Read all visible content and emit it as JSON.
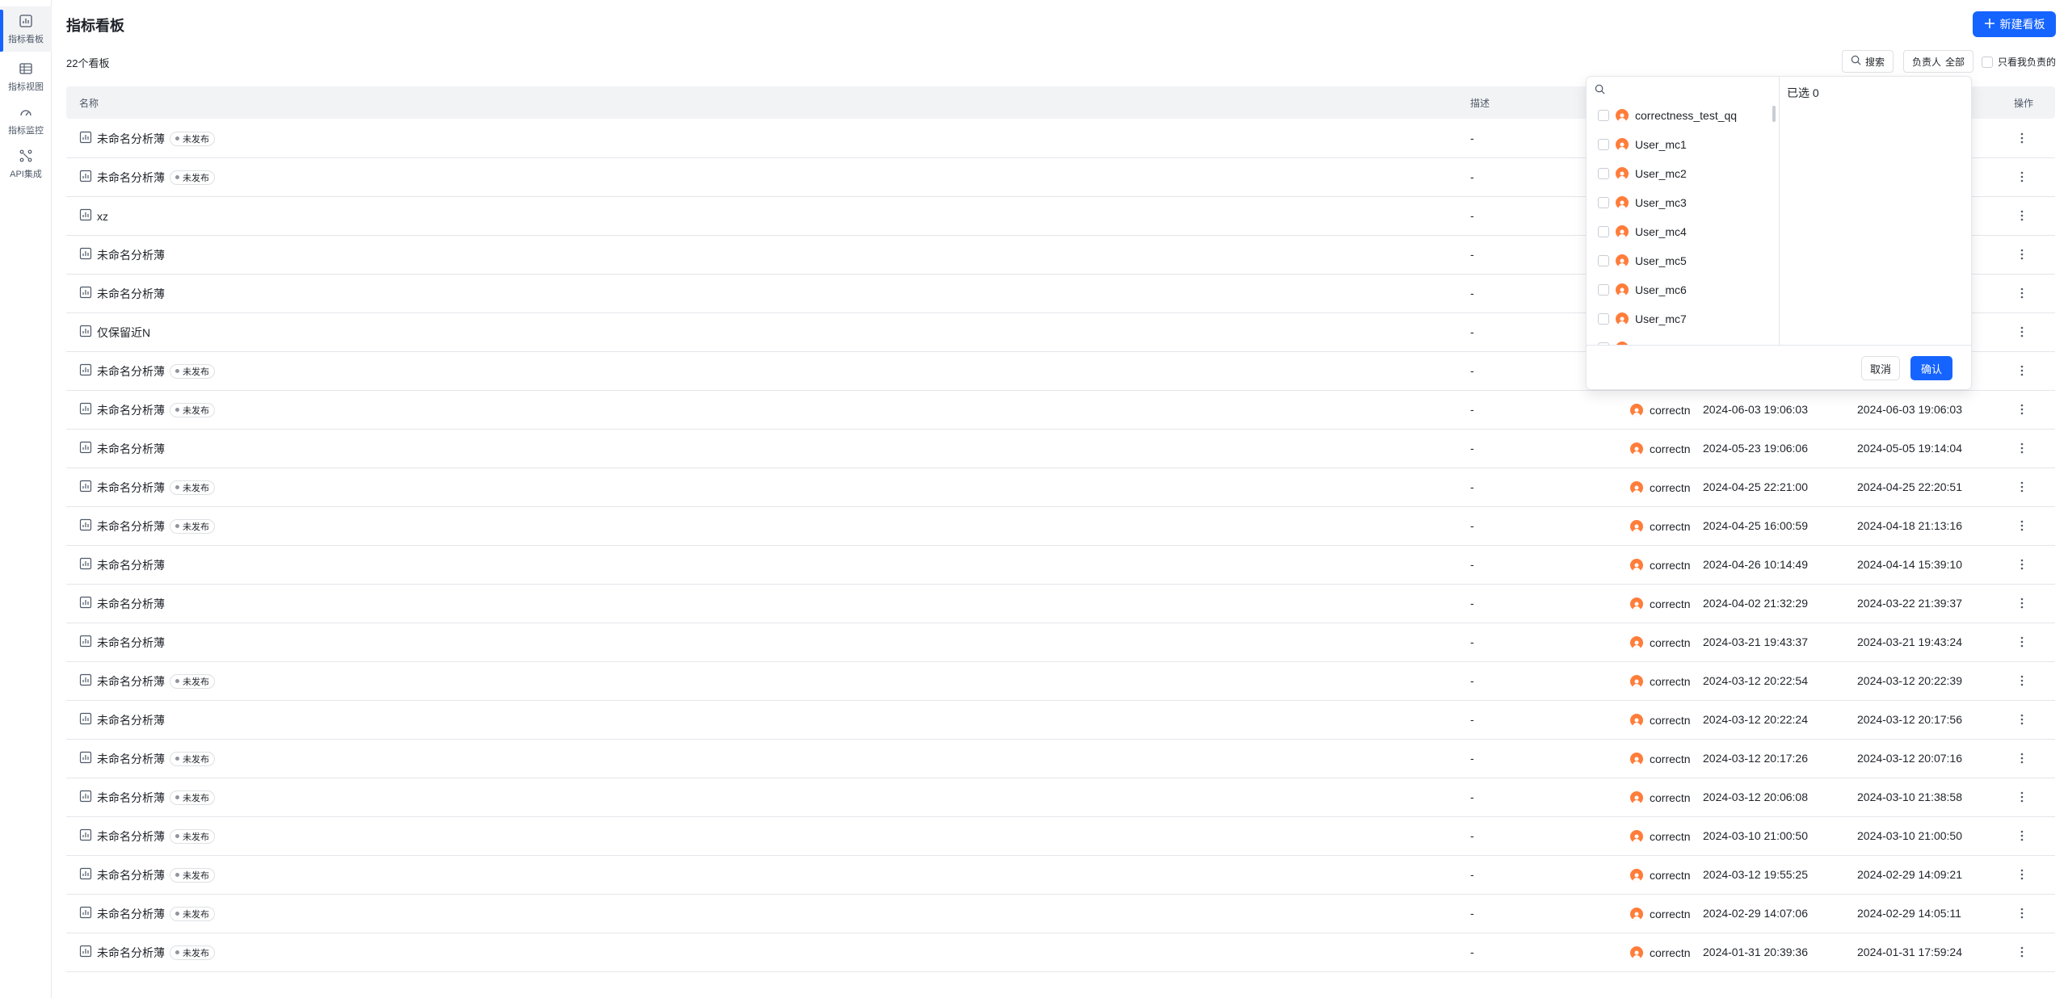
{
  "sidebar": {
    "items": [
      {
        "label": "指标看板",
        "icon": "dashboard-icon"
      },
      {
        "label": "指标视图",
        "icon": "table-icon"
      },
      {
        "label": "指标监控",
        "icon": "gauge-icon"
      },
      {
        "label": "API集成",
        "icon": "api-icon"
      }
    ]
  },
  "header": {
    "title": "指标看板",
    "new_button": "新建看板"
  },
  "toolbar": {
    "count": "22个看板",
    "search_label": "搜索",
    "owner_label": "负责人",
    "owner_value": "全部",
    "only_mine": "只看我负责的"
  },
  "table": {
    "columns": {
      "name": "名称",
      "desc": "描述",
      "op": "操作"
    },
    "badge_label": "未发布",
    "rows": [
      {
        "name": "未命名分析薄",
        "badge": true,
        "desc": "-",
        "owner": "",
        "t1": "",
        "t2": ""
      },
      {
        "name": "未命名分析薄",
        "badge": true,
        "desc": "-",
        "owner": "",
        "t1": "",
        "t2": ""
      },
      {
        "name": "xz",
        "badge": false,
        "desc": "-",
        "owner": "",
        "t1": "",
        "t2": ""
      },
      {
        "name": "未命名分析薄",
        "badge": false,
        "desc": "-",
        "owner": "",
        "t1": "",
        "t2": ""
      },
      {
        "name": "未命名分析薄",
        "badge": false,
        "desc": "-",
        "owner": "",
        "t1": "",
        "t2": ""
      },
      {
        "name": "仅保留近N",
        "badge": false,
        "desc": "-",
        "owner": "",
        "t1": "",
        "t2": ""
      },
      {
        "name": "未命名分析薄",
        "badge": true,
        "desc": "-",
        "owner": "",
        "t1": "",
        "t2": ""
      },
      {
        "name": "未命名分析薄",
        "badge": true,
        "desc": "-",
        "owner": "correctn",
        "t1": "2024-06-03 19:06:03",
        "t2": "2024-06-03 19:06:03"
      },
      {
        "name": "未命名分析薄",
        "badge": false,
        "desc": "-",
        "owner": "correctn",
        "t1": "2024-05-23 19:06:06",
        "t2": "2024-05-05 19:14:04"
      },
      {
        "name": "未命名分析薄",
        "badge": true,
        "desc": "-",
        "owner": "correctn",
        "t1": "2024-04-25 22:21:00",
        "t2": "2024-04-25 22:20:51"
      },
      {
        "name": "未命名分析薄",
        "badge": true,
        "desc": "-",
        "owner": "correctn",
        "t1": "2024-04-25 16:00:59",
        "t2": "2024-04-18 21:13:16"
      },
      {
        "name": "未命名分析薄",
        "badge": false,
        "desc": "-",
        "owner": "correctn",
        "t1": "2024-04-26 10:14:49",
        "t2": "2024-04-14 15:39:10"
      },
      {
        "name": "未命名分析薄",
        "badge": false,
        "desc": "-",
        "owner": "correctn",
        "t1": "2024-04-02 21:32:29",
        "t2": "2024-03-22 21:39:37"
      },
      {
        "name": "未命名分析薄",
        "badge": false,
        "desc": "-",
        "owner": "correctn",
        "t1": "2024-03-21 19:43:37",
        "t2": "2024-03-21 19:43:24"
      },
      {
        "name": "未命名分析薄",
        "badge": true,
        "desc": "-",
        "owner": "correctn",
        "t1": "2024-03-12 20:22:54",
        "t2": "2024-03-12 20:22:39"
      },
      {
        "name": "未命名分析薄",
        "badge": false,
        "desc": "-",
        "owner": "correctn",
        "t1": "2024-03-12 20:22:24",
        "t2": "2024-03-12 20:17:56"
      },
      {
        "name": "未命名分析薄",
        "badge": true,
        "desc": "-",
        "owner": "correctn",
        "t1": "2024-03-12 20:17:26",
        "t2": "2024-03-12 20:07:16"
      },
      {
        "name": "未命名分析薄",
        "badge": true,
        "desc": "-",
        "owner": "correctn",
        "t1": "2024-03-12 20:06:08",
        "t2": "2024-03-10 21:38:58"
      },
      {
        "name": "未命名分析薄",
        "badge": true,
        "desc": "-",
        "owner": "correctn",
        "t1": "2024-03-10 21:00:50",
        "t2": "2024-03-10 21:00:50"
      },
      {
        "name": "未命名分析薄",
        "badge": true,
        "desc": "-",
        "owner": "correctn",
        "t1": "2024-03-12 19:55:25",
        "t2": "2024-02-29 14:09:21"
      },
      {
        "name": "未命名分析薄",
        "badge": true,
        "desc": "-",
        "owner": "correctn",
        "t1": "2024-02-29 14:07:06",
        "t2": "2024-02-29 14:05:11"
      },
      {
        "name": "未命名分析薄",
        "badge": true,
        "desc": "-",
        "owner": "correctn",
        "t1": "2024-01-31 20:39:36",
        "t2": "2024-01-31 17:59:24"
      }
    ]
  },
  "popover": {
    "search_placeholder": "",
    "selected_label": "已选 0",
    "users": [
      "correctness_test_qq",
      "User_mc1",
      "User_mc2",
      "User_mc3",
      "User_mc4",
      "User_mc5",
      "User_mc6",
      "User_mc7"
    ],
    "cancel_label": "取消",
    "confirm_label": "确认"
  },
  "colors": {
    "primary": "#1664ff",
    "avatar": "#ff7d3a",
    "header_bg": "#f2f3f5"
  }
}
